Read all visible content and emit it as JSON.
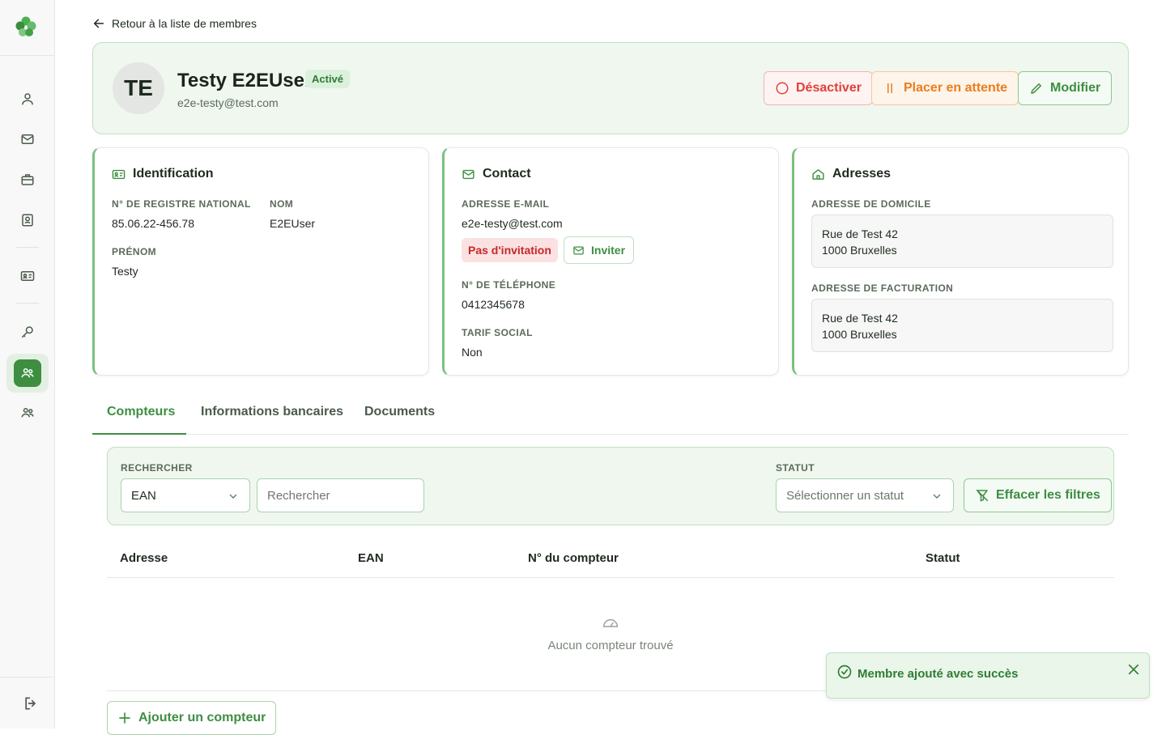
{
  "back_link": "Retour à la liste de membres",
  "member": {
    "initials": "TE",
    "name": "Testy E2EUser",
    "status": "Activé",
    "email": "e2e-testy@test.com"
  },
  "actions": {
    "deactivate": "Désactiver",
    "hold": "Placer en attente",
    "edit": "Modifier"
  },
  "identification": {
    "title": "Identification",
    "nrn_label": "N° de registre national",
    "nrn_value": "85.06.22-456.78",
    "lastname_label": "Nom",
    "lastname_value": "E2EUser",
    "firstname_label": "Prénom",
    "firstname_value": "Testy"
  },
  "contact": {
    "title": "Contact",
    "email_label": "Adresse e-mail",
    "email_value": "e2e-testy@test.com",
    "invitation_status": "Pas d'invitation",
    "invite_button": "Inviter",
    "phone_label": "N° de téléphone",
    "phone_value": "0412345678",
    "social_label": "Tarif social",
    "social_value": "Non"
  },
  "addresses": {
    "title": "Adresses",
    "home_label": "Adresse de domicile",
    "home_line1": "Rue de Test 42",
    "home_line2": "1000 Bruxelles",
    "billing_label": "Adresse de facturation",
    "billing_line1": "Rue de Test 42",
    "billing_line2": "1000 Bruxelles"
  },
  "tabs": {
    "meters": "Compteurs",
    "bank": "Informations bancaires",
    "documents": "Documents"
  },
  "filters": {
    "search_label": "Rechercher",
    "search_type": "EAN",
    "search_placeholder": "Rechercher",
    "status_label": "Statut",
    "status_placeholder": "Sélectionner un statut",
    "clear_button": "Effacer les filtres"
  },
  "table": {
    "col_address": "Adresse",
    "col_ean": "EAN",
    "col_meter": "N° du compteur",
    "col_status": "Statut",
    "empty_text": "Aucun compteur trouvé"
  },
  "add_meter_button": "Ajouter un compteur",
  "toast": {
    "message": "Membre ajouté avec succès"
  },
  "colors": {
    "primary": "#3e8e41",
    "danger": "#e0413a",
    "warning": "#ec7d1c",
    "background_tint": "#eff7ef"
  },
  "icons": [
    "clover-logo-icon",
    "user-icon",
    "mail-icon",
    "briefcase-icon",
    "contact-book-icon",
    "id-card-icon",
    "key-icon",
    "members-icon",
    "group-icon",
    "logout-icon"
  ]
}
